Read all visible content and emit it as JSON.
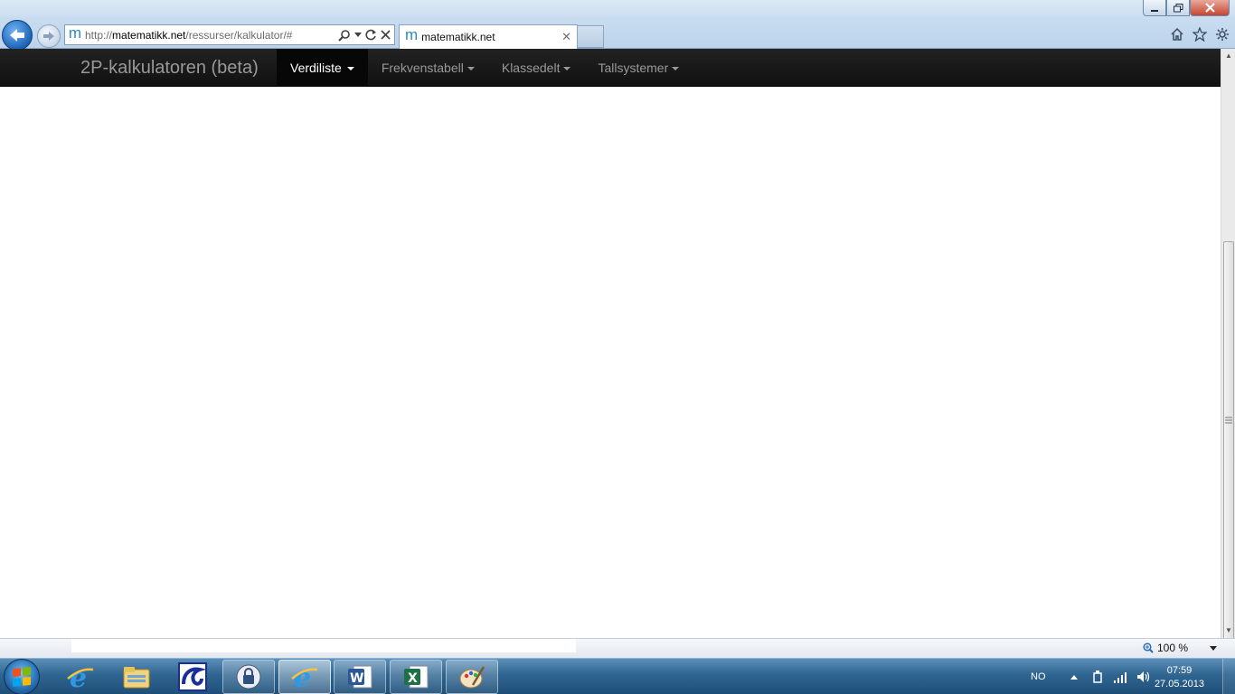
{
  "browser": {
    "address": {
      "prefix": "http://",
      "host": "matematikk.net",
      "path": "/ressurser/kalkulator/#"
    },
    "tab": {
      "title": "matematikk.net",
      "favicon": "m"
    }
  },
  "navbar": {
    "brand": "2P-kalkulatoren (beta)",
    "items": [
      {
        "label": "Verdiliste",
        "active": true
      },
      {
        "label": "Frekvenstabell",
        "active": false
      },
      {
        "label": "Klassedelt",
        "active": false
      },
      {
        "label": "Tallsystemer",
        "active": false
      }
    ]
  },
  "statusbar": {
    "zoom": "100 %"
  },
  "taskbar": {
    "apps": [
      {
        "name": "internet-explorer-icon",
        "state": "pinned"
      },
      {
        "name": "windows-explorer-icon",
        "state": "pinned"
      },
      {
        "name": "app-logo-icon",
        "state": "pinned"
      },
      {
        "name": "usb-lock-icon",
        "state": "running"
      },
      {
        "name": "internet-explorer-icon",
        "state": "active"
      },
      {
        "name": "word-icon",
        "state": "running"
      },
      {
        "name": "excel-icon",
        "state": "running"
      },
      {
        "name": "paint-icon",
        "state": "running"
      }
    ],
    "language": "NO",
    "time": "07:59",
    "date": "27.05.2013"
  },
  "colors": {
    "navbar_bg": "#1b1b1b",
    "navbar_text": "#999999",
    "navbar_active_text": "#ffffff",
    "taskbar": "#2f6591"
  }
}
